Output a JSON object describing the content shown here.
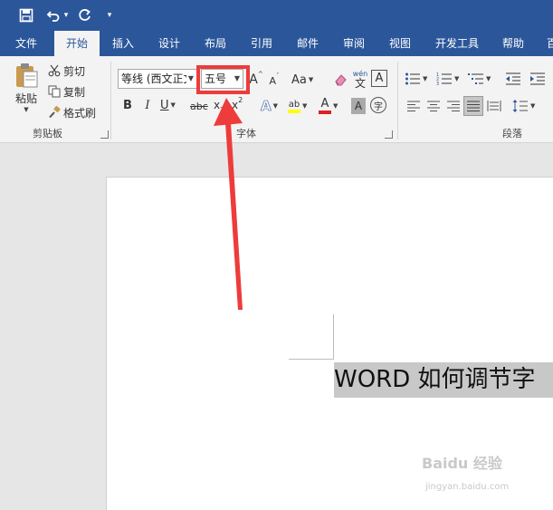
{
  "qat": {
    "undo_caret": "▾",
    "customize": "▾"
  },
  "tabs": [
    "文件",
    "开始",
    "插入",
    "设计",
    "布局",
    "引用",
    "邮件",
    "审阅",
    "视图",
    "开发工具",
    "帮助",
    "百"
  ],
  "clipboard": {
    "paste_label": "粘贴",
    "cut_label": "剪切",
    "copy_label": "复制",
    "format_painter_label": "格式刷",
    "group_label": "剪贴板"
  },
  "font": {
    "font_name": "等线 (西文正文",
    "font_size": "五号",
    "grow_label": "A",
    "shrink_label": "A",
    "change_case_label": "Aa",
    "phonetic_top": "wén",
    "phonetic_bottom": "文",
    "char_border_label": "A",
    "bold": "B",
    "italic": "I",
    "underline": "U",
    "strike": "abc",
    "subscript": "x",
    "sub_mark": "2",
    "superscript": "x",
    "sup_mark": "2",
    "effects_label": "A",
    "highlight_label": "ab",
    "font_color_label": "A",
    "shading_label": "A",
    "enclose_label": "字",
    "group_label": "字体"
  },
  "paragraph": {
    "group_label": "段落"
  },
  "document": {
    "text": "WORD 如何调节字"
  },
  "watermark": {
    "brand": "Baidu 经验",
    "url": "jingyan.baidu.com"
  },
  "colors": {
    "accent": "#2b579a",
    "arrow": "#ee3b3b",
    "highlight_yellow": "#ffff00",
    "font_red": "#e02020"
  }
}
